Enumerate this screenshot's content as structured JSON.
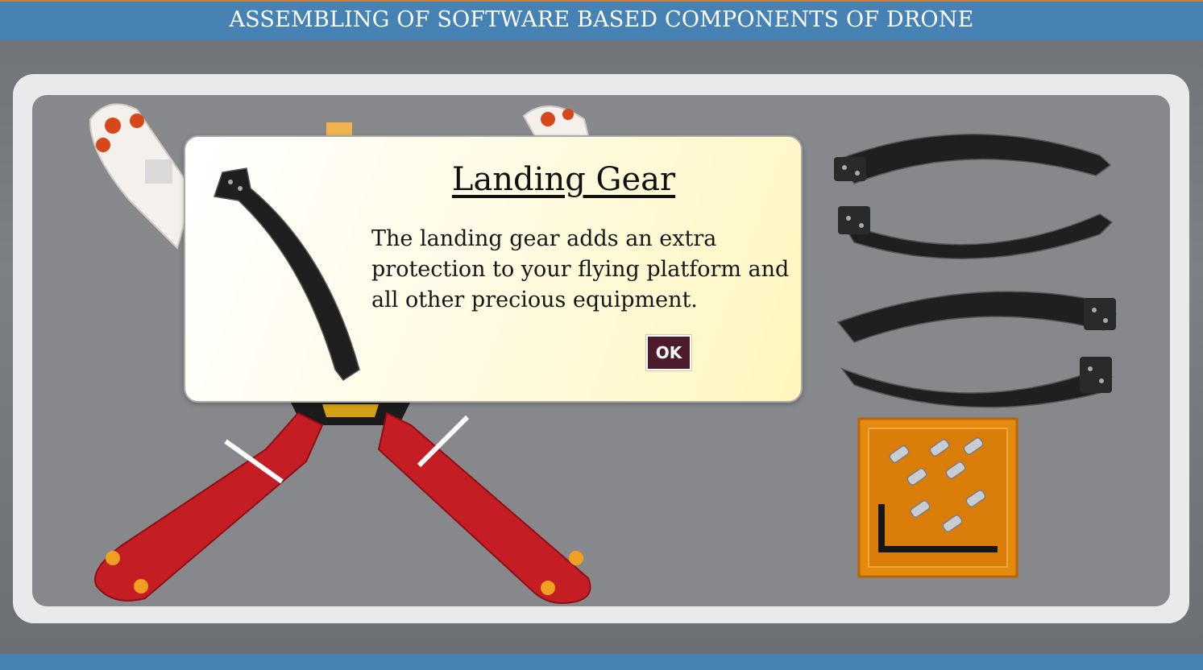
{
  "header": {
    "title": "ASSEMBLING OF SOFTWARE BASED COMPONENTS OF DRONE"
  },
  "modal": {
    "title": "Landing Gear",
    "description": "The landing gear adds an extra protection to your flying platform and all other precious equipment.",
    "ok_label": "OK",
    "image_icon": "landing-gear-icon"
  },
  "parts": {
    "frame_icon": "drone-frame-icon",
    "landing_gear_icon": "landing-gear-icon",
    "landing_gear_count": 4,
    "screw_box_icon": "screw-box-icon"
  },
  "colors": {
    "header_bar": "#4682b4",
    "ok_button": "#4e1b2c",
    "frame_arm_red": "#c41d23",
    "frame_arm_white": "#f4f1ec",
    "screw_box": "#e58a0c"
  }
}
